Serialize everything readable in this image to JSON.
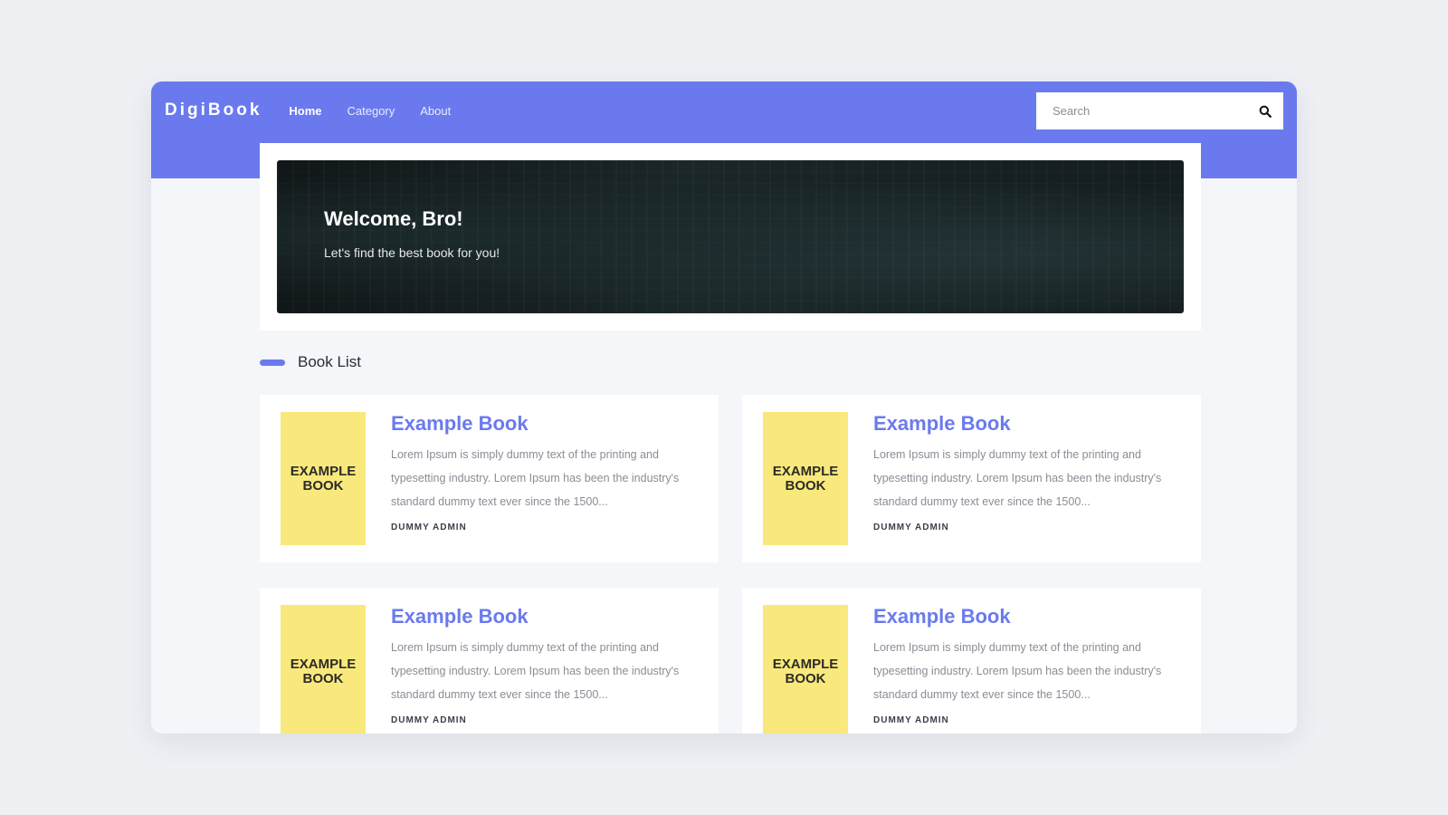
{
  "app": {
    "brand": "DigiBook"
  },
  "nav": {
    "items": [
      {
        "label": "Home",
        "active": true
      },
      {
        "label": "Category",
        "active": false
      },
      {
        "label": "About",
        "active": false
      }
    ]
  },
  "search": {
    "placeholder": "Search",
    "value": "",
    "icon": "search-icon"
  },
  "hero": {
    "title": "Welcome, Bro!",
    "subtitle": "Let's find the best book for you!"
  },
  "section": {
    "title": "Book List"
  },
  "books": [
    {
      "cover_line1": "EXAMPLE",
      "cover_line2": "BOOK",
      "title": "Example Book",
      "description": "Lorem Ipsum is simply dummy text of the printing and typesetting industry. Lorem Ipsum has been the industry's standard dummy text ever since the 1500...",
      "author": "DUMMY ADMIN"
    },
    {
      "cover_line1": "EXAMPLE",
      "cover_line2": "BOOK",
      "title": "Example Book",
      "description": "Lorem Ipsum is simply dummy text of the printing and typesetting industry. Lorem Ipsum has been the industry's standard dummy text ever since the 1500...",
      "author": "DUMMY ADMIN"
    },
    {
      "cover_line1": "EXAMPLE",
      "cover_line2": "BOOK",
      "title": "Example Book",
      "description": "Lorem Ipsum is simply dummy text of the printing and typesetting industry. Lorem Ipsum has been the industry's standard dummy text ever since the 1500...",
      "author": "DUMMY ADMIN"
    },
    {
      "cover_line1": "EXAMPLE",
      "cover_line2": "BOOK",
      "title": "Example Book",
      "description": "Lorem Ipsum is simply dummy text of the printing and typesetting industry. Lorem Ipsum has been the industry's standard dummy text ever since the 1500...",
      "author": "DUMMY ADMIN"
    }
  ],
  "colors": {
    "accent": "#6a7aee",
    "cover": "#f9e97c",
    "page_bg": "#eef0f4"
  }
}
